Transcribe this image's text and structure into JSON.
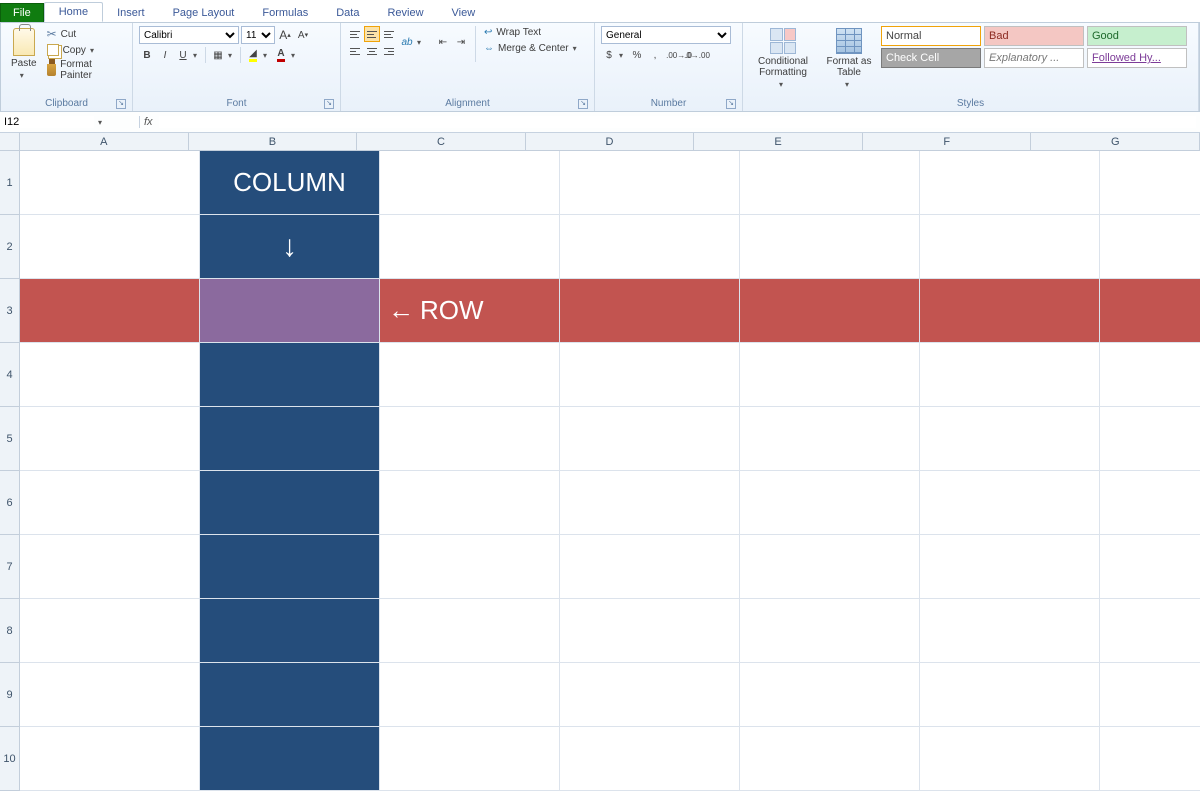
{
  "tabs": {
    "file": "File",
    "home": "Home",
    "insert": "Insert",
    "layout": "Page Layout",
    "formulas": "Formulas",
    "data": "Data",
    "review": "Review",
    "view": "View"
  },
  "clipboard": {
    "paste": "Paste",
    "cut": "Cut",
    "copy": "Copy",
    "painter": "Format Painter",
    "title": "Clipboard"
  },
  "font": {
    "name": "Calibri",
    "size": "11",
    "bold": "B",
    "italic": "I",
    "underline": "U",
    "title": "Font"
  },
  "alignment": {
    "wrap": "Wrap Text",
    "merge": "Merge & Center",
    "title": "Alignment"
  },
  "number": {
    "format": "General",
    "currency": "$",
    "percent": "%",
    "comma": ",",
    "title": "Number"
  },
  "styles": {
    "cond": "Conditional Formatting",
    "table": "Format as Table",
    "normal": "Normal",
    "bad": "Bad",
    "good": "Good",
    "check": "Check Cell",
    "expl": "Explanatory ...",
    "link": "Followed Hy...",
    "title": "Styles"
  },
  "namebox": "I12",
  "formula": "",
  "columns": [
    "A",
    "B",
    "C",
    "D",
    "E",
    "F",
    "G"
  ],
  "rows": [
    "1",
    "2",
    "3",
    "4",
    "5",
    "6",
    "7",
    "8",
    "9",
    "10"
  ],
  "cell_labels": {
    "column": "COLUMN",
    "row": "ROW",
    "down": "↓",
    "left": "←"
  },
  "fx": "fx"
}
